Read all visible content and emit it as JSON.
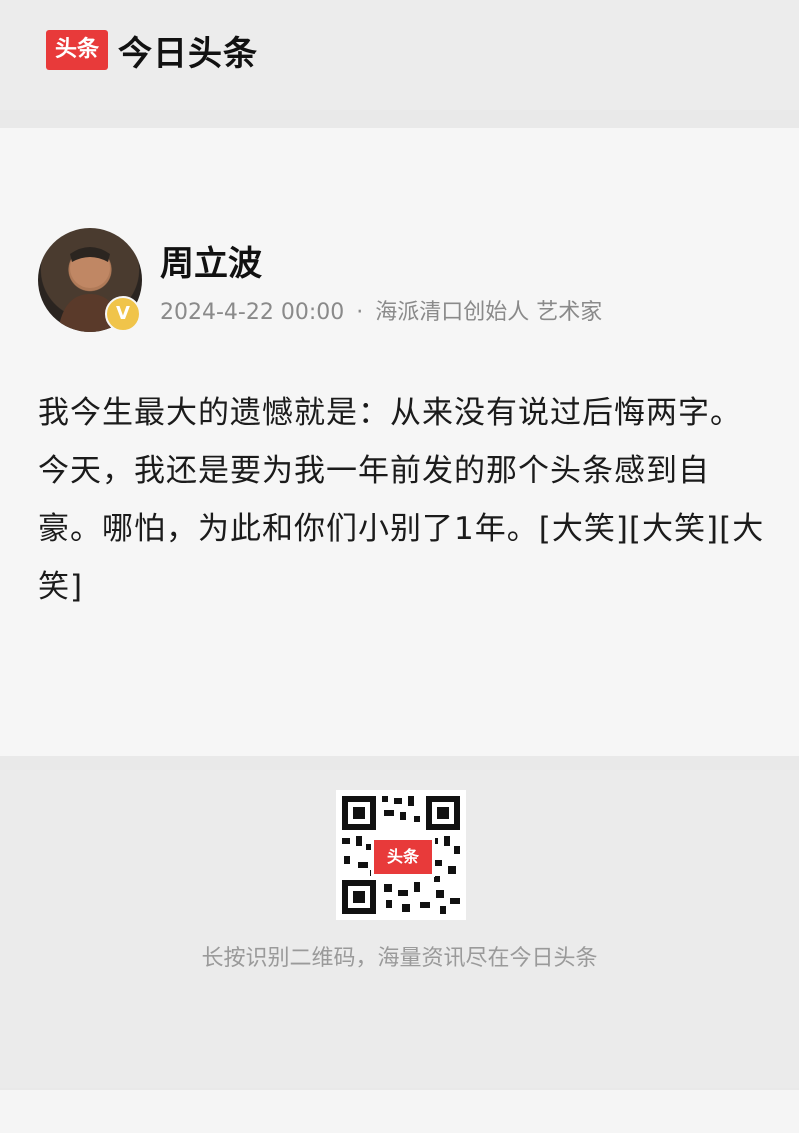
{
  "header": {
    "logo_text": "头条",
    "app_name": "今日头条"
  },
  "author": {
    "name": "周立波",
    "badge": "V",
    "timestamp": "2024-4-22 00:00",
    "separator": "·",
    "description": "海派清口创始人 艺术家"
  },
  "post": {
    "text": "我今生最大的遗憾就是：从来没有说过后悔两字。今天，我还是要为我一年前发的那个头条感到自豪。哪怕，为此和你们小别了1年。[大笑][大笑][大笑]"
  },
  "footer": {
    "qr_label": "头条",
    "caption": "长按识别二维码，海量资讯尽在今日头条"
  }
}
